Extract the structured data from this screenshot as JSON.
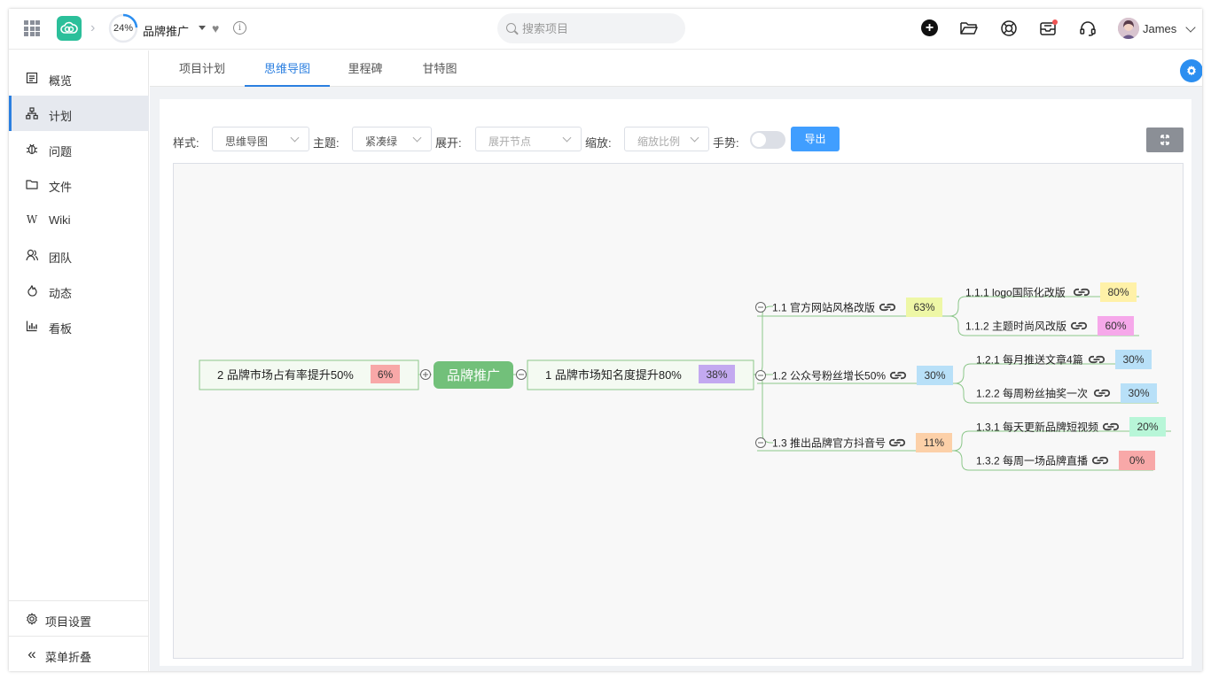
{
  "header": {
    "progress_label": "24%",
    "progress_value": 24,
    "project_name": "品牌推广",
    "search_placeholder": "搜索项目",
    "user_name": "James"
  },
  "sidebar": {
    "items": [
      {
        "label": "概览",
        "icon": "overview-icon"
      },
      {
        "label": "计划",
        "icon": "plan-icon",
        "active": true
      },
      {
        "label": "问题",
        "icon": "bug-icon"
      },
      {
        "label": "文件",
        "icon": "folder-icon"
      },
      {
        "label": "Wiki",
        "icon": "wiki-icon"
      },
      {
        "label": "团队",
        "icon": "team-icon"
      },
      {
        "label": "动态",
        "icon": "activity-icon"
      },
      {
        "label": "看板",
        "icon": "board-icon"
      }
    ],
    "settings_label": "项目设置",
    "collapse_label": "菜单折叠"
  },
  "tabs": [
    {
      "label": "项目计划"
    },
    {
      "label": "思维导图",
      "active": true
    },
    {
      "label": "里程碑"
    },
    {
      "label": "甘特图"
    }
  ],
  "toolbar": {
    "style_label": "样式:",
    "style_value": "思维导图",
    "theme_label": "主题:",
    "theme_value": "紧凑绿",
    "expand_label": "展开:",
    "expand_placeholder": "展开节点",
    "zoom_label": "缩放:",
    "zoom_placeholder": "缩放比例",
    "gesture_label": "手势:",
    "export_label": "导出"
  },
  "mindmap": {
    "root": "品牌推广",
    "left_branch": {
      "label": "2 品牌市场占有率提升50%",
      "percent": "6%",
      "color": "#f8a8a8"
    },
    "right_branch": {
      "label": "1 品牌市场知名度提升80%",
      "percent": "38%",
      "color": "#c3a9f0"
    },
    "children": [
      {
        "label": "1.1 官方网站风格改版",
        "percent": "63%",
        "color": "#eef7a6",
        "children": [
          {
            "label": "1.1.1 logo国际化改版",
            "percent": "80%",
            "color": "#fff1a8"
          },
          {
            "label": "1.1.2 主题时尚风改版",
            "percent": "60%",
            "color": "#f6a8ea"
          }
        ]
      },
      {
        "label": "1.2 公众号粉丝增长50%",
        "percent": "30%",
        "color": "#b8e0f8",
        "children": [
          {
            "label": "1.2.1 每月推送文章4篇",
            "percent": "30%",
            "color": "#b8e0f8"
          },
          {
            "label": "1.2.2 每周粉丝抽奖一次",
            "percent": "30%",
            "color": "#b8e0f8"
          }
        ]
      },
      {
        "label": "1.3 推出品牌官方抖音号",
        "percent": "11%",
        "color": "#fcd0a8",
        "children": [
          {
            "label": "1.3.1 每天更新品牌短视频",
            "percent": "20%",
            "color": "#b8f6d8"
          },
          {
            "label": "1.3.2 每周一场品牌直播",
            "percent": "0%",
            "color": "#f8a8a8"
          }
        ]
      }
    ]
  }
}
